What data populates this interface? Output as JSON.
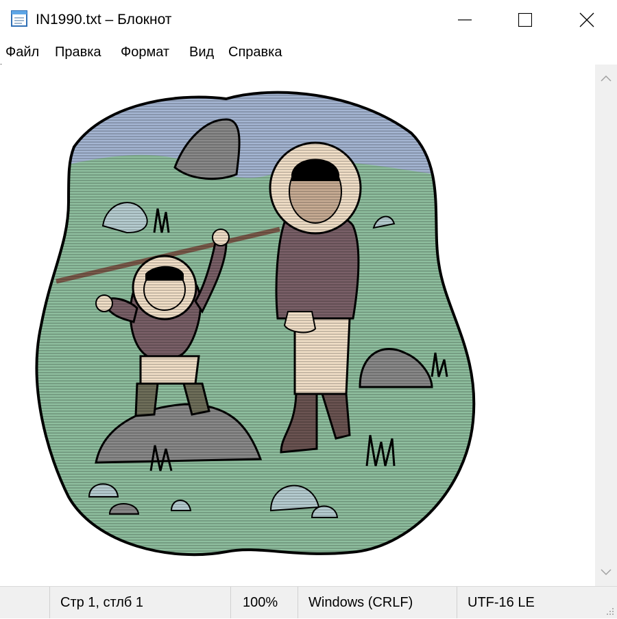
{
  "window": {
    "title": "IN1990.txt – Блокнот",
    "icon": "notepad-icon",
    "controls": {
      "minimize": "minimize-icon",
      "maximize": "maximize-icon",
      "close": "close-icon"
    }
  },
  "menu": {
    "items": [
      "Файл",
      "Правка",
      "Формат",
      "Вид",
      "Справка"
    ]
  },
  "editor": {
    "content_type": "ascii-art-illustration",
    "description_icon": "inuit-father-and-child-ascii-art",
    "colors": {
      "sky": "#a5b6d3",
      "grass": "#8fbf9f",
      "rock": "#8a8a8a",
      "parka": "#7a6068",
      "fur": "#f3e1c9",
      "outline": "#000000"
    }
  },
  "statusbar": {
    "position": "Стр 1, стлб 1",
    "zoom": "100%",
    "line_endings": "Windows (CRLF)",
    "encoding": "UTF-16 LE"
  }
}
